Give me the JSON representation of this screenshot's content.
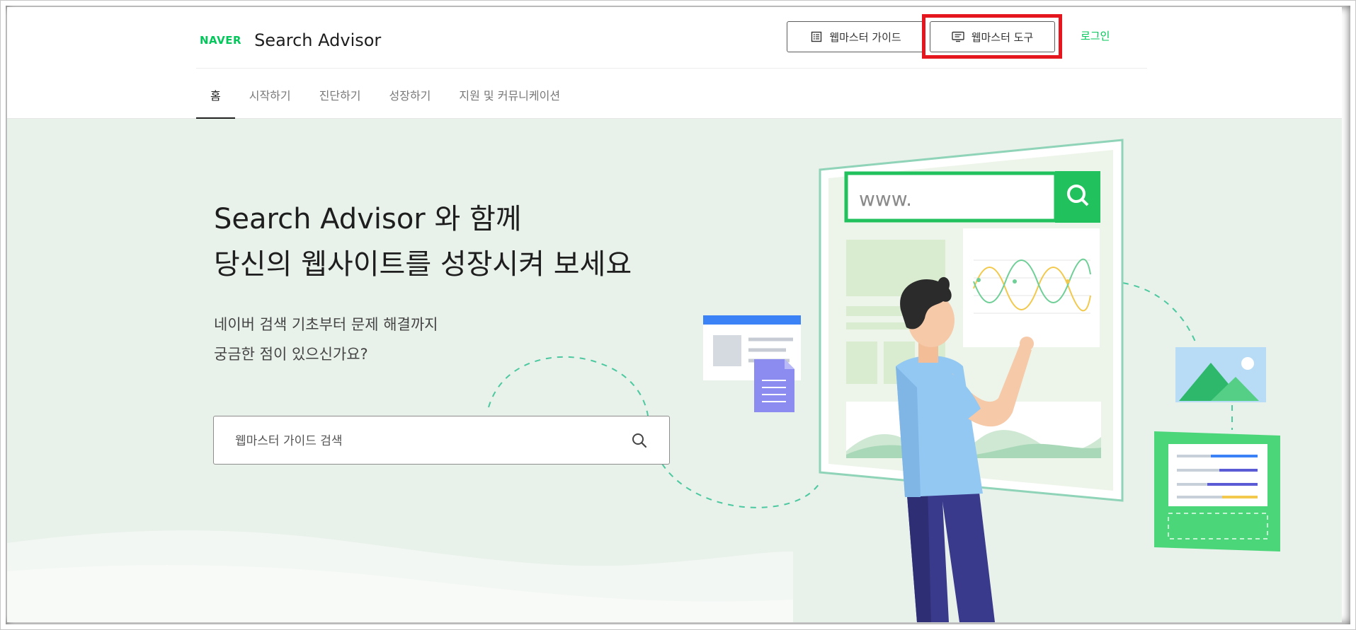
{
  "brand": {
    "logo_text": "NAVER",
    "title": "Search Advisor"
  },
  "header": {
    "guide_label": "웹마스터 가이드",
    "tool_label": "웹마스터 도구",
    "login_label": "로그인"
  },
  "nav": {
    "items": [
      {
        "label": "홈",
        "active": true
      },
      {
        "label": "시작하기"
      },
      {
        "label": "진단하기"
      },
      {
        "label": "성장하기"
      },
      {
        "label": "지원 및 커뮤니케이션"
      }
    ]
  },
  "hero": {
    "headline_1": "Search Advisor 와 함께",
    "headline_2": "당신의 웹사이트를 성장시켜 보세요",
    "sub_1": "네이버 검색 기초부터 문제 해결까지",
    "sub_2": "궁금한 점이 있으신가요?",
    "search_placeholder": "웹마스터 가이드 검색",
    "illustration_url_text": "www."
  },
  "colors": {
    "brand_green": "#03c75a",
    "hero_bg": "#e8f1ea",
    "highlight_red": "#e5161d"
  },
  "icons": {
    "guide": "document-list-icon",
    "tool": "monitor-icon",
    "search": "search-icon"
  }
}
